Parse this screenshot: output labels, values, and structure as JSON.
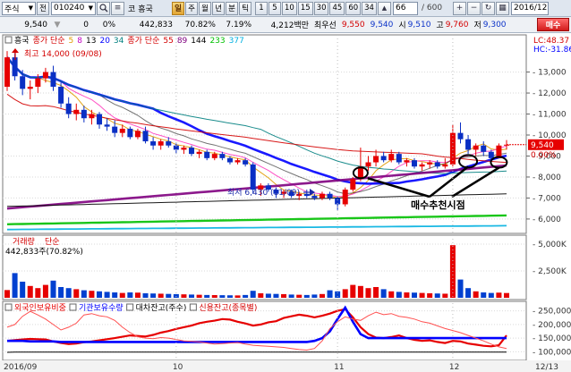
{
  "toolbar": {
    "market_type": "주식",
    "prefix_label": "전",
    "stock_code": "010240",
    "market_label": "코",
    "stock_name": "흥국",
    "period_buttons": [
      {
        "label": "일",
        "active": true
      },
      {
        "label": "주",
        "active": false
      },
      {
        "label": "월",
        "active": false
      },
      {
        "label": "년",
        "active": false
      },
      {
        "label": "분",
        "active": false
      },
      {
        "label": "틱",
        "active": false
      }
    ],
    "interval_buttons": [
      "1",
      "5",
      "10",
      "15",
      "30",
      "45",
      "60",
      "34"
    ],
    "count_value": "66",
    "count_total": "/ 600",
    "date_value": "2016/12"
  },
  "info": {
    "price": "9,540",
    "change_prefix": "▼",
    "change": "0",
    "change_pct": "0%",
    "volume": "442,833",
    "volume_ratio": "70.82%",
    "turnover": "7.19%",
    "amount": "4,212백만",
    "ask_label": "최우선",
    "ask": "9,550",
    "bid": "9,540",
    "open_label": "시",
    "open": "9,510",
    "high_label": "고",
    "high": "9,760",
    "low_label": "저",
    "low": "9,300",
    "trade_button": "매수"
  },
  "chart_data": [
    {
      "type": "candlestick",
      "legend": [
        {
          "text": "흥국",
          "color": "#000000"
        },
        {
          "text": "종가 단순",
          "color": "#d40000"
        },
        {
          "text": "5",
          "color": "#e09b00"
        },
        {
          "text": "8",
          "color": "#c000c0"
        },
        {
          "text": "13",
          "color": "#000000"
        },
        {
          "text": "20",
          "color": "#0000ff"
        },
        {
          "text": "34",
          "color": "#008080"
        },
        {
          "text": "종가 단순",
          "color": "#d40000"
        },
        {
          "text": "55",
          "color": "#d40000"
        },
        {
          "text": "89",
          "color": "#800080"
        },
        {
          "text": "144",
          "color": "#000000"
        },
        {
          "text": "233",
          "color": "#00c000"
        },
        {
          "text": "377",
          "color": "#00b0e0"
        }
      ],
      "top_right_labels": [
        "LC:48.37",
        "HC:-31.86"
      ],
      "annotations": {
        "high_label": "최고 14,000 (09/08)",
        "low_label": "최저 6,430 (11/09)",
        "buy_signal_label": "매수추천시점"
      },
      "y_ticks": [
        13000,
        12000,
        11000,
        10000,
        9000,
        8000,
        7000,
        6000
      ],
      "y_tick_labels": [
        "13,000",
        "12,000",
        "11,000",
        "10,000",
        "9,000",
        "8,000",
        "7,000",
        "6,000"
      ],
      "ylim": [
        5400,
        14600
      ],
      "current_price_label": "9,540",
      "current_price": 9540,
      "current_pct_label": "0.00%",
      "x_labels": [
        "2016/09",
        "10",
        "11",
        "12",
        "12/13"
      ],
      "candles": [
        [
          12300,
          14000,
          12100,
          13700
        ],
        [
          13700,
          13900,
          12600,
          12800
        ],
        [
          12800,
          13100,
          11900,
          12200
        ],
        [
          12200,
          12600,
          11700,
          12300
        ],
        [
          12300,
          12900,
          12000,
          12700
        ],
        [
          12700,
          13200,
          12500,
          13000
        ],
        [
          13000,
          13300,
          12100,
          12300
        ],
        [
          12300,
          12500,
          11300,
          11500
        ],
        [
          11500,
          11800,
          10800,
          11000
        ],
        [
          11000,
          11500,
          10700,
          11200
        ],
        [
          11200,
          11400,
          10600,
          10800
        ],
        [
          10800,
          11200,
          10500,
          11000
        ],
        [
          11000,
          11100,
          10300,
          10500
        ],
        [
          10500,
          10800,
          10200,
          10400
        ],
        [
          10400,
          10700,
          9900,
          10100
        ],
        [
          10100,
          10500,
          9900,
          10300
        ],
        [
          10300,
          10400,
          9800,
          9900
        ],
        [
          9900,
          10300,
          9800,
          10200
        ],
        [
          10200,
          10400,
          9600,
          9700
        ],
        [
          9700,
          9900,
          9300,
          9500
        ],
        [
          9500,
          9800,
          9300,
          9700
        ],
        [
          9700,
          9900,
          9400,
          9500
        ],
        [
          9500,
          9600,
          9100,
          9300
        ],
        [
          9300,
          9500,
          9100,
          9400
        ],
        [
          9400,
          9500,
          9000,
          9100
        ],
        [
          9100,
          9300,
          8900,
          9200
        ],
        [
          9200,
          9300,
          8800,
          8900
        ],
        [
          8900,
          9200,
          8800,
          9100
        ],
        [
          9100,
          9200,
          8800,
          8900
        ],
        [
          8900,
          9000,
          8600,
          8700
        ],
        [
          8700,
          8900,
          8600,
          8800
        ],
        [
          8800,
          8900,
          8500,
          8600
        ],
        [
          8600,
          8700,
          7200,
          7400
        ],
        [
          7400,
          7700,
          7100,
          7600
        ],
        [
          7600,
          7700,
          7300,
          7400
        ],
        [
          7400,
          7500,
          7000,
          7200
        ],
        [
          7200,
          7400,
          7000,
          7300
        ],
        [
          7300,
          7400,
          7000,
          7100
        ],
        [
          7100,
          7300,
          6900,
          7200
        ],
        [
          7200,
          7400,
          7000,
          7100
        ],
        [
          7100,
          7200,
          6900,
          7000
        ],
        [
          7000,
          7300,
          6900,
          7200
        ],
        [
          7200,
          7300,
          6900,
          7000
        ],
        [
          7000,
          7100,
          6430,
          6700
        ],
        [
          6700,
          7500,
          6600,
          7400
        ],
        [
          7400,
          8000,
          7300,
          7900
        ],
        [
          7900,
          9400,
          7800,
          8500
        ],
        [
          8500,
          9000,
          8300,
          8700
        ],
        [
          8700,
          9300,
          8500,
          9000
        ],
        [
          9000,
          9200,
          8700,
          8800
        ],
        [
          8800,
          9300,
          8700,
          9100
        ],
        [
          9100,
          9200,
          8600,
          8700
        ],
        [
          8700,
          8900,
          8500,
          8800
        ],
        [
          8800,
          8900,
          8400,
          8500
        ],
        [
          8500,
          8700,
          8300,
          8600
        ],
        [
          8600,
          8800,
          8400,
          8700
        ],
        [
          8700,
          8800,
          8400,
          8500
        ],
        [
          8500,
          8900,
          8400,
          8600
        ],
        [
          8600,
          10500,
          8500,
          10100
        ],
        [
          10100,
          10600,
          9600,
          9800
        ],
        [
          9800,
          10000,
          9100,
          9300
        ],
        [
          9300,
          9600,
          9000,
          9500
        ],
        [
          9500,
          9700,
          9000,
          9200
        ],
        [
          9200,
          9300,
          8700,
          8900
        ],
        [
          8900,
          9600,
          8900,
          9500
        ],
        [
          9510,
          9760,
          9300,
          9540
        ]
      ],
      "ma_series": [
        {
          "period": 5,
          "color": "#e09b00"
        },
        {
          "period": 8,
          "color": "#ff3fbf"
        },
        {
          "period": 13,
          "color": "#000000"
        },
        {
          "period": 20,
          "color": "#0000ff"
        },
        {
          "period": 34,
          "color": "#008080"
        },
        {
          "period": 55,
          "color": "#d40000"
        },
        {
          "period": 89,
          "color": "#800080"
        },
        {
          "period": 144,
          "color": "#000000"
        },
        {
          "period": 233,
          "color": "#00c000"
        },
        {
          "period": 377,
          "color": "#00b0e0"
        }
      ]
    },
    {
      "type": "bar",
      "title": "거래량",
      "subtitle": "단순",
      "value_label": "442,833주(70.82%)",
      "y_ticks": [
        5000000,
        2500000
      ],
      "y_tick_labels": [
        "5,000K",
        "2,500K"
      ],
      "ylim": [
        0,
        5500000
      ],
      "values": [
        720000,
        2300000,
        1500000,
        1100000,
        900000,
        1200000,
        1600000,
        1000000,
        900000,
        800000,
        700000,
        650000,
        600000,
        550000,
        500000,
        450000,
        500000,
        480000,
        420000,
        400000,
        380000,
        360000,
        340000,
        320000,
        300000,
        280000,
        260000,
        250000,
        240000,
        230000,
        220000,
        260000,
        650000,
        420000,
        380000,
        360000,
        340000,
        300000,
        280000,
        260000,
        300000,
        350000,
        700000,
        600000,
        800000,
        1200000,
        1100000,
        900000,
        1000000,
        800000,
        600000,
        550000,
        500000,
        480000,
        450000,
        420000,
        400000,
        380000,
        4900000,
        1700000,
        900000,
        600000,
        500000,
        450000,
        480000,
        442833
      ],
      "up_color": "#e60000",
      "down_color": "#0040d0"
    },
    {
      "type": "line",
      "legend": [
        {
          "text": "외국인보유비중",
          "color": "#e60000"
        },
        {
          "text": "기관보유수량",
          "color": "#0000ff"
        },
        {
          "text": "대차잔고(주수)",
          "color": "#000000"
        },
        {
          "text": "신용잔고(종목별)",
          "color": "#d40000"
        }
      ],
      "y_ticks": [
        250000,
        200000,
        150000,
        100000
      ],
      "y_tick_labels": [
        "250,000",
        "200,000",
        "150,000",
        "100,000"
      ],
      "ylim": [
        75000,
        275000
      ],
      "series": [
        {
          "name": "외국인보유비중",
          "color": "#e60000",
          "width": 2.2,
          "values": [
            140000,
            143000,
            145000,
            147000,
            146000,
            145000,
            138000,
            132000,
            128000,
            130000,
            135000,
            138000,
            142000,
            146000,
            150000,
            155000,
            160000,
            158000,
            156000,
            162000,
            170000,
            176000,
            184000,
            190000,
            196000,
            205000,
            210000,
            214000,
            220000,
            218000,
            210000,
            204000,
            196000,
            200000,
            208000,
            212000,
            224000,
            230000,
            236000,
            232000,
            226000,
            232000,
            240000,
            250000,
            256000,
            226000,
            190000,
            165000,
            152000,
            150000,
            154000,
            160000,
            150000,
            144000,
            140000,
            142000,
            136000,
            132000,
            140000,
            138000,
            130000,
            126000,
            122000,
            120000,
            124000,
            160000
          ]
        },
        {
          "name": "기관보유수량",
          "color": "#0000ff",
          "width": 2.6,
          "values": [
            140000,
            140000,
            140000,
            138000,
            138000,
            138000,
            138000,
            136000,
            136000,
            136000,
            136000,
            136000,
            136000,
            136000,
            136000,
            136000,
            136000,
            136000,
            136000,
            136000,
            136000,
            136000,
            136000,
            136000,
            136000,
            136000,
            136000,
            136000,
            136000,
            136000,
            136000,
            136000,
            136000,
            136000,
            136000,
            136000,
            136000,
            136000,
            136000,
            136000,
            140000,
            150000,
            175000,
            220000,
            262000,
            210000,
            165000,
            150000,
            150000,
            150000,
            150000,
            150000,
            150000,
            150000,
            150000,
            150000,
            150000,
            150000,
            150000,
            150000,
            150000,
            150000,
            150000,
            150000,
            150000,
            150000
          ]
        },
        {
          "name": "대차잔고(주수)",
          "color": "#000000",
          "width": 1,
          "values": [
            98000,
            99000,
            98500,
            99000,
            99000,
            99000,
            99000,
            99000,
            99000,
            99000,
            99000,
            99000,
            99000,
            99000,
            99000,
            99000,
            99000,
            99000,
            99000,
            99000,
            99000,
            99000,
            99000,
            99000,
            99000,
            99000,
            99000,
            99000,
            99000,
            99000,
            99000,
            99000,
            99000,
            99000,
            99000,
            99000,
            99000,
            99000,
            99000,
            99000,
            99000,
            99000,
            99000,
            99000,
            99000,
            99000,
            99000,
            99000,
            99000,
            99000,
            99000,
            99000,
            99000,
            99000,
            99000,
            99000,
            99000,
            99000,
            99000,
            99000,
            99000,
            99000,
            99000,
            99000,
            99000,
            99000
          ]
        },
        {
          "name": "신용잔고(종목별)",
          "color": "#ff5050",
          "width": 1,
          "values": [
            190000,
            200000,
            230000,
            248000,
            235000,
            220000,
            200000,
            180000,
            190000,
            205000,
            235000,
            240000,
            232000,
            228000,
            215000,
            190000,
            170000,
            155000,
            150000,
            148000,
            152000,
            150000,
            145000,
            140000,
            138000,
            136000,
            132000,
            128000,
            130000,
            132000,
            134000,
            128000,
            124000,
            122000,
            120000,
            118000,
            116000,
            112000,
            108000,
            106000,
            112000,
            140000,
            185000,
            210000,
            228000,
            220000,
            215000,
            232000,
            245000,
            236000,
            240000,
            230000,
            226000,
            220000,
            210000,
            205000,
            195000,
            185000,
            178000,
            170000,
            160000,
            150000,
            140000,
            128000,
            118000,
            112000
          ]
        }
      ]
    }
  ]
}
